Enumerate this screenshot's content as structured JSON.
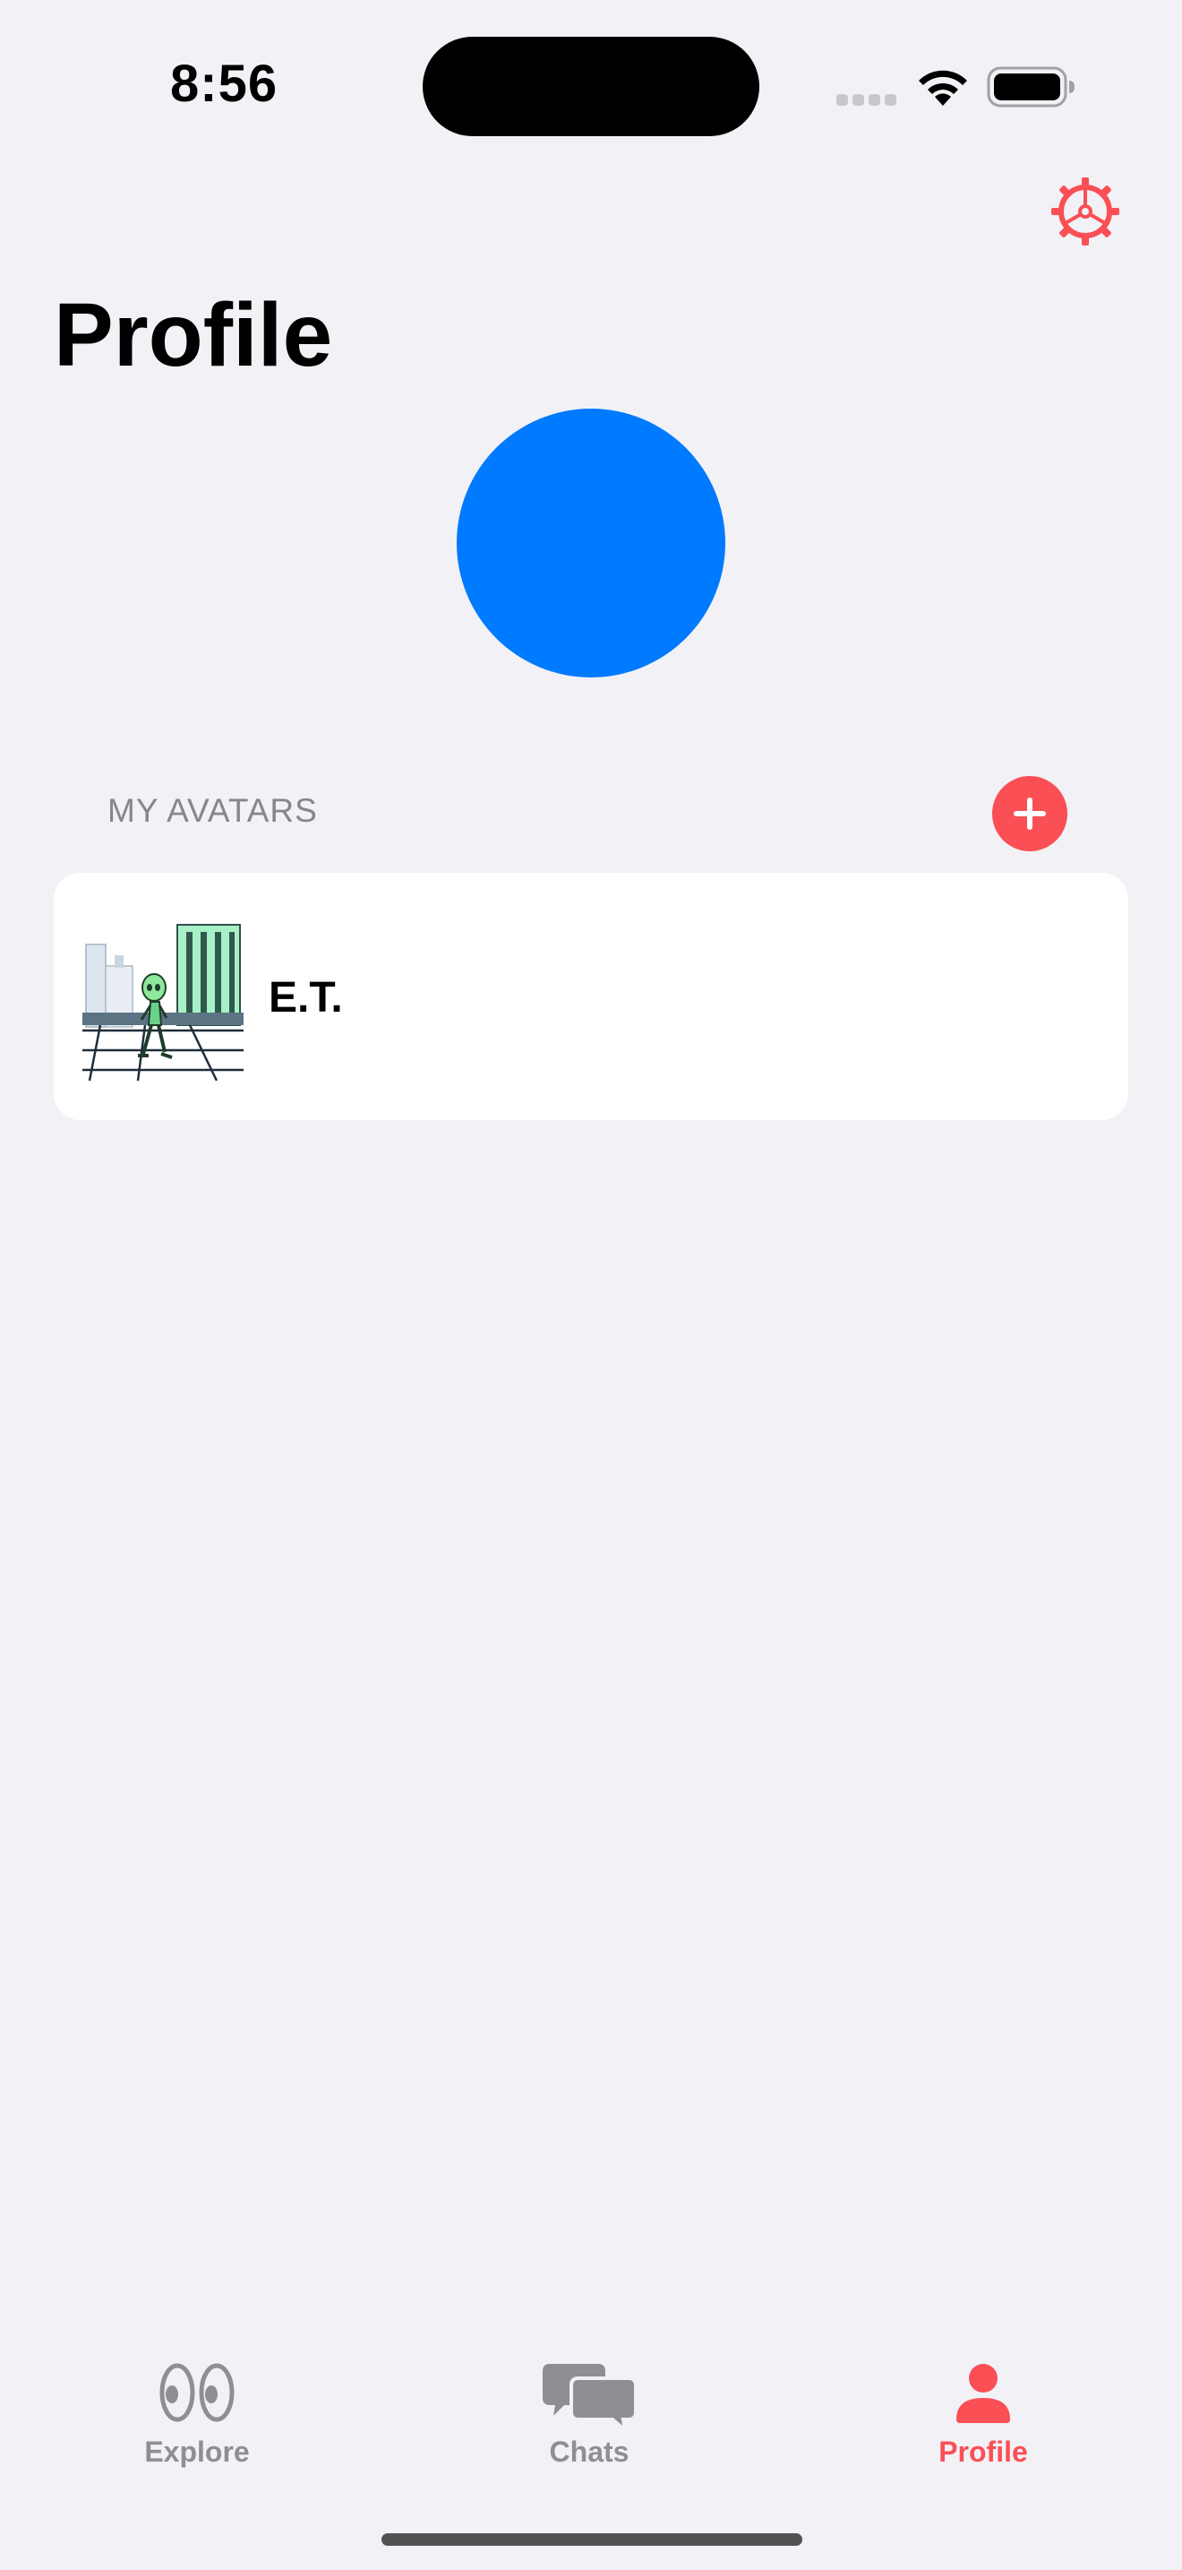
{
  "status_bar": {
    "time": "8:56",
    "icons": [
      "signal-icon",
      "wifi-icon",
      "battery-icon"
    ]
  },
  "header": {
    "title": "Profile",
    "settings_icon": "gear-icon"
  },
  "profile": {
    "avatar_color": "#007AFF"
  },
  "avatars_section": {
    "header": "MY AVATARS",
    "add_icon": "plus-icon",
    "items": [
      {
        "name": "E.T.",
        "thumbnail": "alien-walking-in-city-illustration"
      }
    ]
  },
  "tab_bar": {
    "tabs": [
      {
        "label": "Explore",
        "icon": "eyes-icon",
        "selected": false
      },
      {
        "label": "Chats",
        "icon": "chat-bubbles-icon",
        "selected": false
      },
      {
        "label": "Profile",
        "icon": "person-icon",
        "selected": true
      }
    ]
  },
  "colors": {
    "accent": "#F94F55",
    "background": "#F2F1F6",
    "inactive_tab": "#8E8E93",
    "section_header": "#86868B"
  }
}
